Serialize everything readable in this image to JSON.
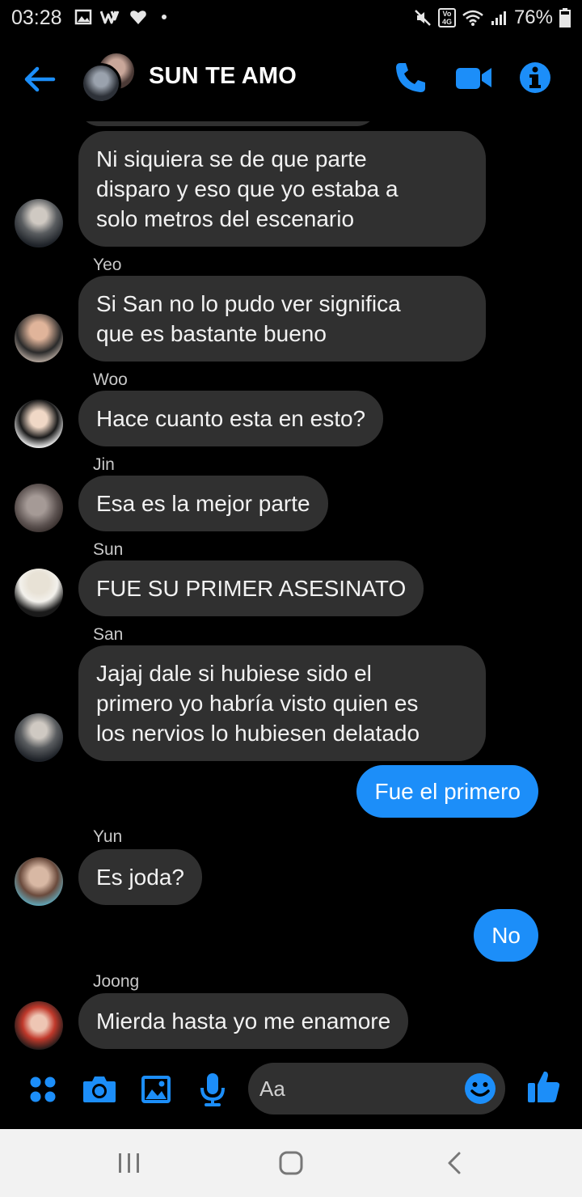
{
  "status_bar": {
    "time": "03:28",
    "battery": "76%",
    "network": "4G",
    "volte": "Vo"
  },
  "header": {
    "title": "SUN TE AMO",
    "icons": [
      "back-arrow-icon",
      "phone-icon",
      "video-camera-icon",
      "info-icon"
    ],
    "accent_color": "#1c8ef9"
  },
  "messages": [
    {
      "direction": "in",
      "sender": "",
      "text_lines": [
        "Ni siquiera se de que parte",
        "disparo y eso que yo estaba a",
        "solo metros del escenario"
      ]
    },
    {
      "direction": "in",
      "sender": "Yeo",
      "text_lines": [
        "Si San no lo pudo ver significa",
        "que es bastante bueno"
      ]
    },
    {
      "direction": "in",
      "sender": "Woo",
      "text_lines": [
        "Hace cuanto esta en esto?"
      ]
    },
    {
      "direction": "in",
      "sender": "Jin",
      "text_lines": [
        "Esa es la mejor parte"
      ]
    },
    {
      "direction": "in",
      "sender": "Sun",
      "text_lines": [
        "FUE SU PRIMER ASESINATO"
      ]
    },
    {
      "direction": "in",
      "sender": "San",
      "text_lines": [
        "Jajaj dale si hubiese sido el",
        "primero yo habría visto quien es",
        "los nervios lo hubiesen delatado"
      ]
    },
    {
      "direction": "out",
      "sender": "",
      "text_lines": [
        "Fue el primero"
      ]
    },
    {
      "direction": "in",
      "sender": "Yun",
      "text_lines": [
        "Es joda?"
      ]
    },
    {
      "direction": "out",
      "sender": "",
      "text_lines": [
        "No"
      ]
    },
    {
      "direction": "in",
      "sender": "Joong",
      "text_lines": [
        "Mierda hasta yo me enamore"
      ]
    }
  ],
  "composer": {
    "placeholder": "Aa",
    "icons": [
      "apps-menu-icon",
      "camera-icon",
      "gallery-icon",
      "microphone-icon",
      "emoji-icon",
      "thumbs-up-icon"
    ]
  },
  "navbar": {
    "icons": [
      "recent-apps-icon",
      "home-icon",
      "back-icon"
    ]
  },
  "colors": {
    "background": "#000000",
    "incoming_bubble": "#303030",
    "outgoing_bubble": "#1c8ef9",
    "sender_label": "#c8c8c8"
  }
}
